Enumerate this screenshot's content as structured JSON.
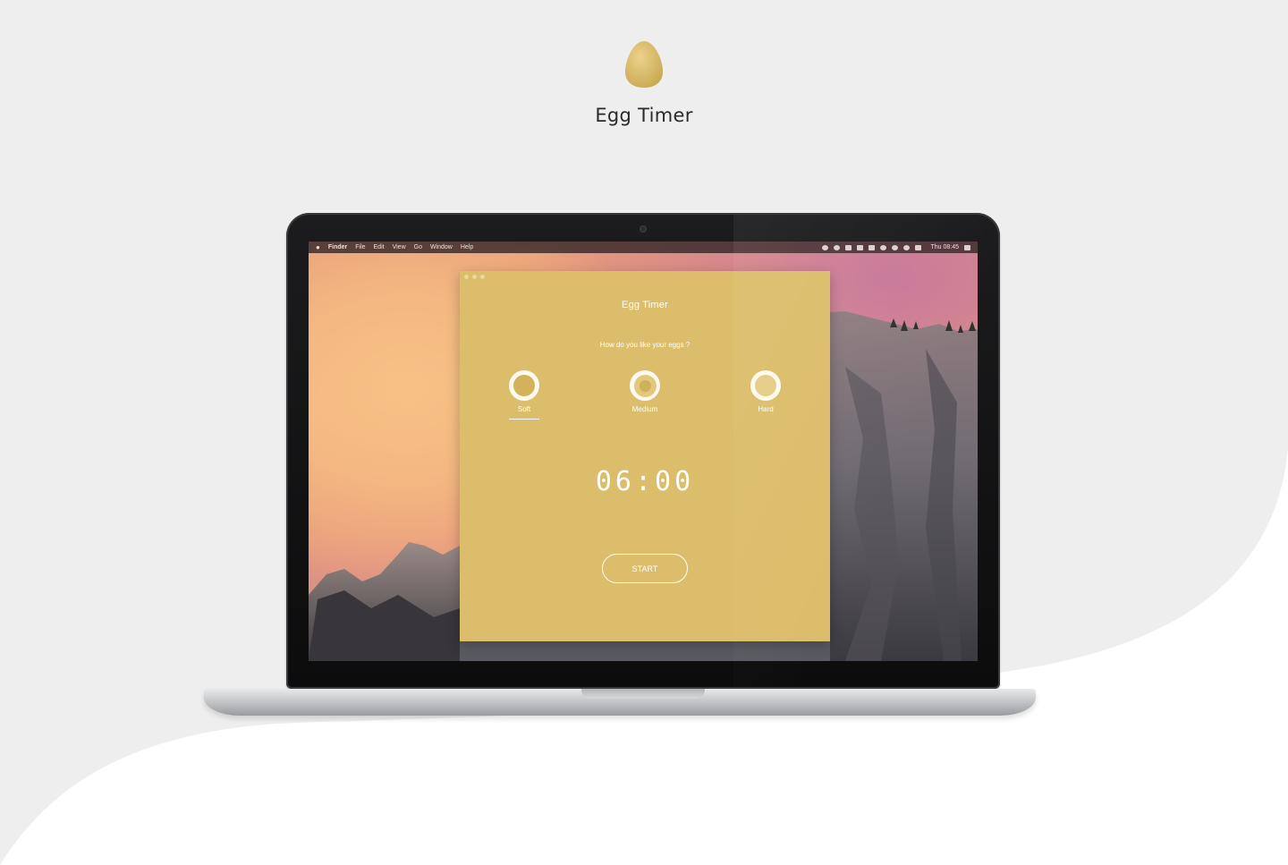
{
  "brand": {
    "title": "Egg Timer",
    "logo_icon": "egg-icon",
    "logo_color": "#dcbd6b"
  },
  "menubar": {
    "apple_icon": "",
    "items": [
      "Finder",
      "File",
      "Edit",
      "View",
      "Go",
      "Window",
      "Help"
    ],
    "clock": "Thu 08:45"
  },
  "app": {
    "title": "Egg Timer",
    "question": "How do you like your eggs ?",
    "background_color": "#dcbd6b",
    "options": [
      {
        "label": "Soft",
        "selected": true
      },
      {
        "label": "Medium",
        "selected": false
      },
      {
        "label": "Hard",
        "selected": false
      }
    ],
    "timer": "06:00",
    "start_label": "START"
  }
}
